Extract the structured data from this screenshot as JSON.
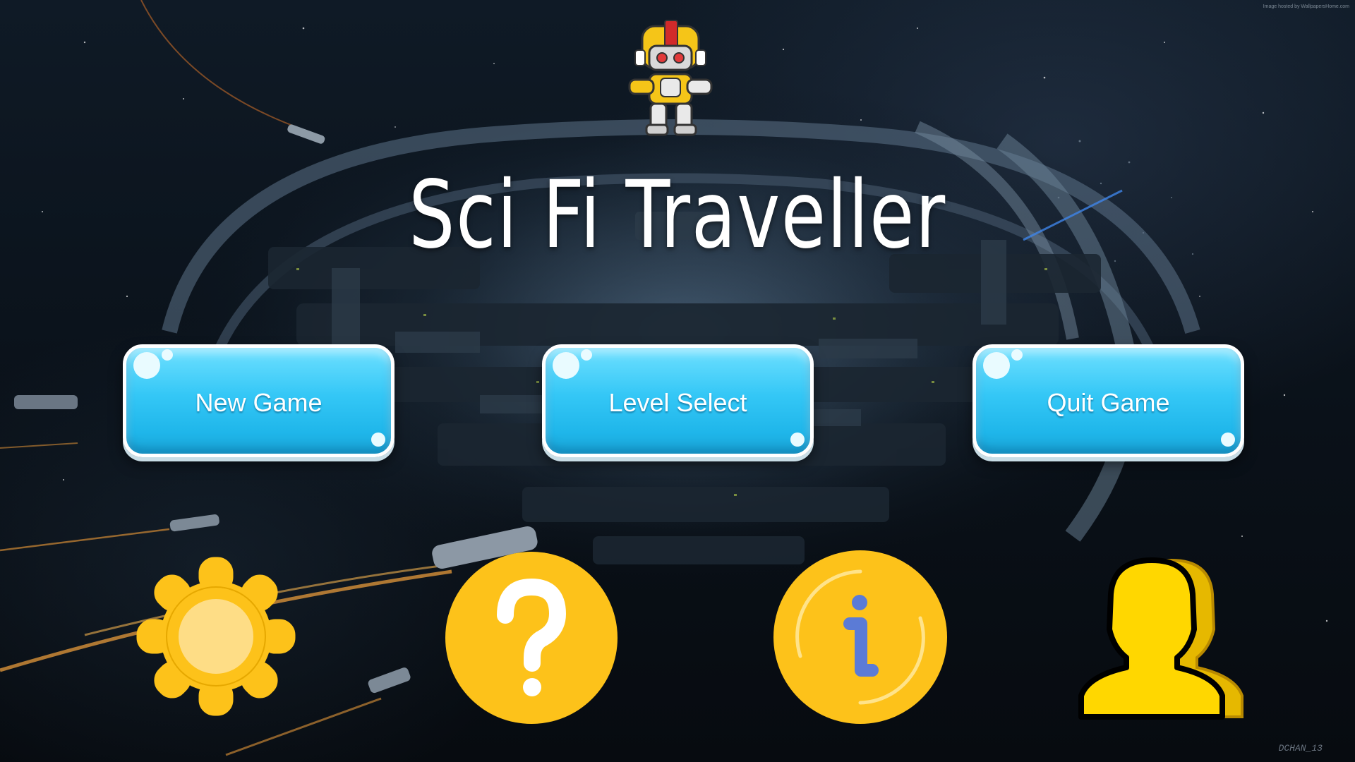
{
  "title": "Sci Fi Traveller",
  "watermark": "Image hosted by WallpapersHome.com",
  "signature": "DCHAN_13",
  "menu": {
    "new_game": "New Game",
    "level_select": "Level Select",
    "quit_game": "Quit Game"
  },
  "icons": {
    "settings": "gear-icon",
    "help": "question-icon",
    "info": "info-icon",
    "credits": "users-icon"
  },
  "colors": {
    "button_blue": "#34c7f6",
    "icon_yellow": "#fdc21a",
    "title_white": "#ffffff"
  }
}
